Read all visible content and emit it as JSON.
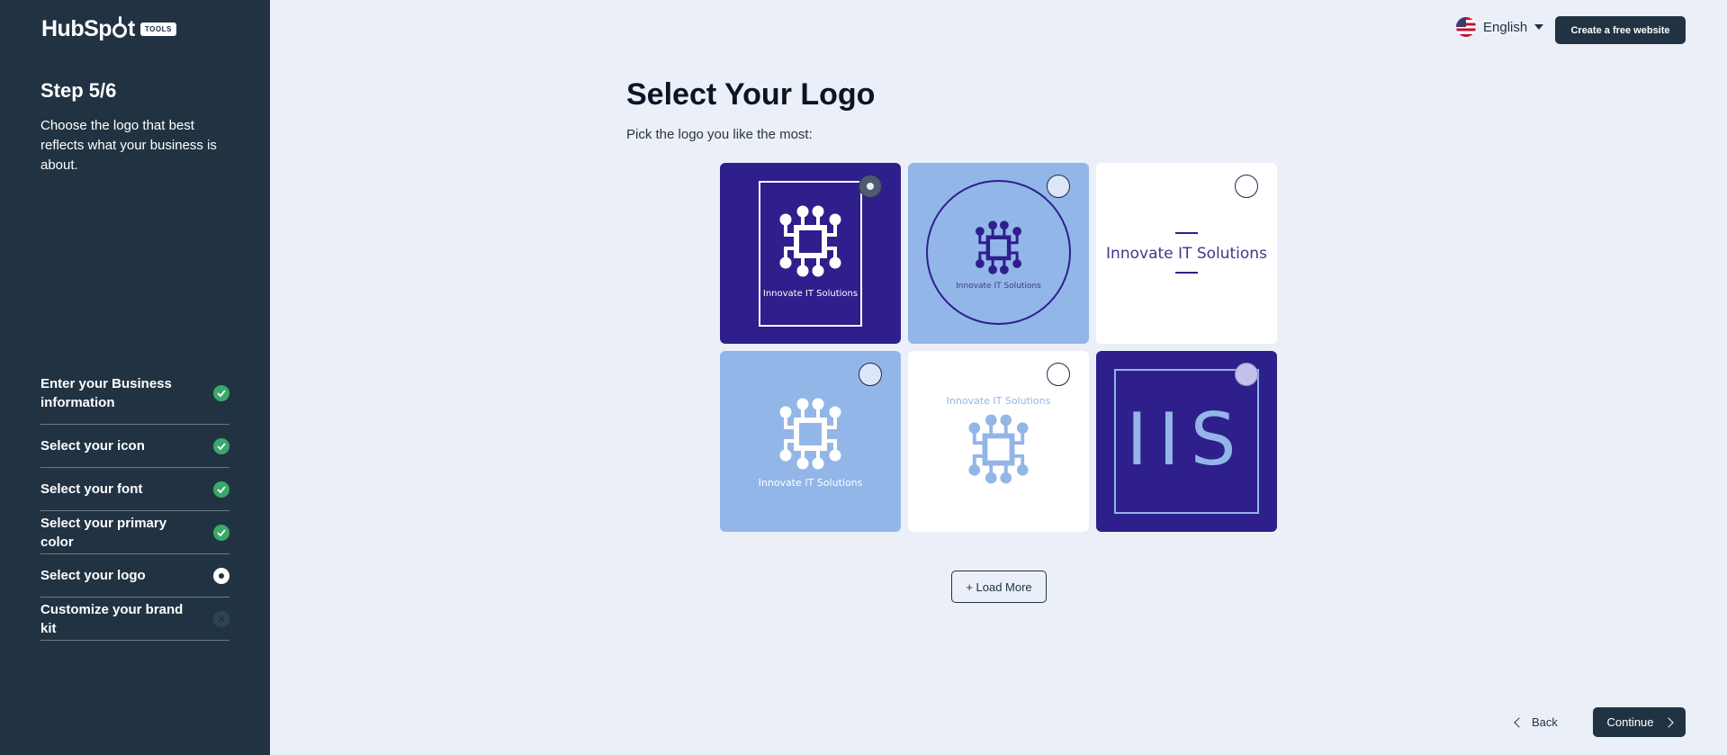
{
  "brand": {
    "name_part1": "HubSp",
    "name_part2": "t",
    "tag": "TOOLS"
  },
  "sidebar": {
    "step_title": "Step 5/6",
    "step_description": "Choose the logo that best reflects what your business is about.",
    "steps": [
      {
        "label": "Enter your Business information",
        "status": "done"
      },
      {
        "label": "Select your icon",
        "status": "done"
      },
      {
        "label": "Select your font",
        "status": "done"
      },
      {
        "label": "Select your primary color",
        "status": "done"
      },
      {
        "label": "Select your logo",
        "status": "current"
      },
      {
        "label": "Customize your brand kit",
        "status": "pending"
      }
    ]
  },
  "header": {
    "language": "English",
    "create_button": "Create a free website"
  },
  "main": {
    "title": "Select Your Logo",
    "subtitle": "Pick the logo you like the most:",
    "logos": [
      {
        "text": "Innovate IT Solutions",
        "selected": true
      },
      {
        "text": "Innovate IT Solutions",
        "selected": false
      },
      {
        "text": "Innovate IT Solutions",
        "selected": false
      },
      {
        "text": "Innovate IT Solutions",
        "selected": false
      },
      {
        "text": "Innovate IT Solutions",
        "selected": false
      },
      {
        "text": "IIS",
        "selected": false
      }
    ],
    "load_more": "+ Load More"
  },
  "footer": {
    "back": "Back",
    "continue": "Continue"
  },
  "colors": {
    "sidebar_bg": "#213343",
    "page_bg": "#ebeff7",
    "logo_dark": "#2e1f8c",
    "logo_light": "#93b6e8",
    "success": "#3aa869"
  }
}
